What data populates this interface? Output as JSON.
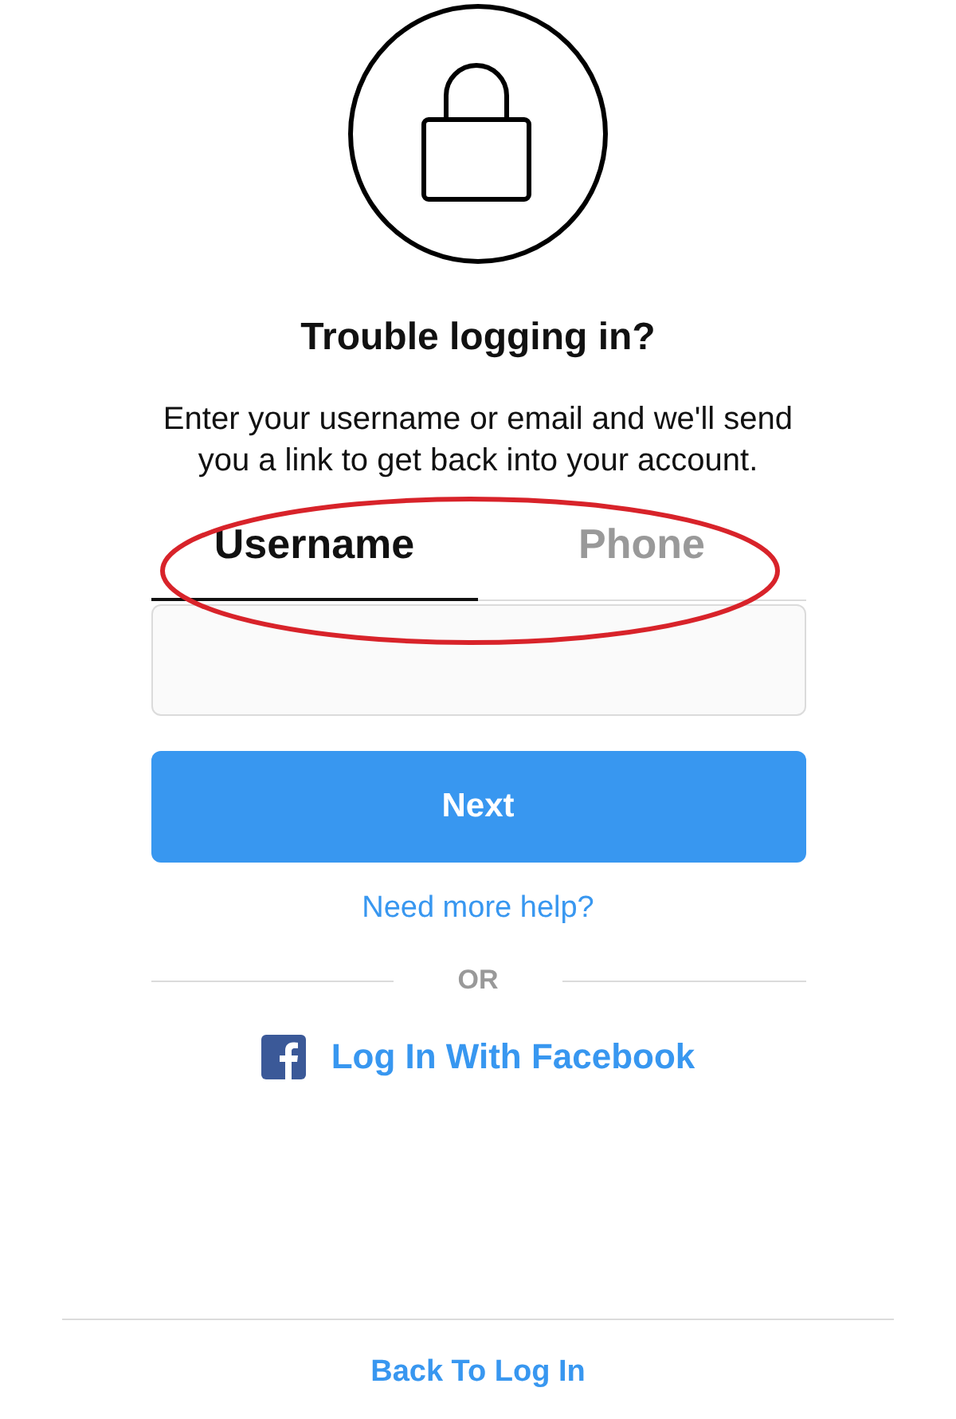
{
  "title": "Trouble logging in?",
  "description": "Enter your username or email and we'll send you a link to get back into your account.",
  "tabs": [
    {
      "label": "Username",
      "selected": true
    },
    {
      "label": "Phone",
      "selected": false
    }
  ],
  "next_button": "Next",
  "help_link": "Need more help?",
  "separator": "OR",
  "facebook_login": "Log In With Facebook",
  "back_link": "Back To Log In"
}
